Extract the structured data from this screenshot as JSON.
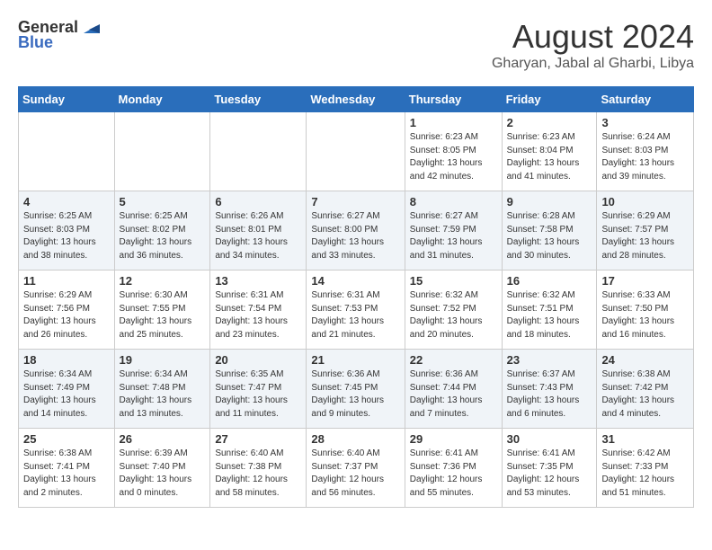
{
  "header": {
    "logo": {
      "general": "General",
      "blue": "Blue"
    },
    "title": "August 2024",
    "location": "Gharyan, Jabal al Gharbi, Libya"
  },
  "days_of_week": [
    "Sunday",
    "Monday",
    "Tuesday",
    "Wednesday",
    "Thursday",
    "Friday",
    "Saturday"
  ],
  "weeks": [
    [
      {
        "day": "",
        "content": ""
      },
      {
        "day": "",
        "content": ""
      },
      {
        "day": "",
        "content": ""
      },
      {
        "day": "",
        "content": ""
      },
      {
        "day": "1",
        "content": "Sunrise: 6:23 AM\nSunset: 8:05 PM\nDaylight: 13 hours\nand 42 minutes."
      },
      {
        "day": "2",
        "content": "Sunrise: 6:23 AM\nSunset: 8:04 PM\nDaylight: 13 hours\nand 41 minutes."
      },
      {
        "day": "3",
        "content": "Sunrise: 6:24 AM\nSunset: 8:03 PM\nDaylight: 13 hours\nand 39 minutes."
      }
    ],
    [
      {
        "day": "4",
        "content": "Sunrise: 6:25 AM\nSunset: 8:03 PM\nDaylight: 13 hours\nand 38 minutes."
      },
      {
        "day": "5",
        "content": "Sunrise: 6:25 AM\nSunset: 8:02 PM\nDaylight: 13 hours\nand 36 minutes."
      },
      {
        "day": "6",
        "content": "Sunrise: 6:26 AM\nSunset: 8:01 PM\nDaylight: 13 hours\nand 34 minutes."
      },
      {
        "day": "7",
        "content": "Sunrise: 6:27 AM\nSunset: 8:00 PM\nDaylight: 13 hours\nand 33 minutes."
      },
      {
        "day": "8",
        "content": "Sunrise: 6:27 AM\nSunset: 7:59 PM\nDaylight: 13 hours\nand 31 minutes."
      },
      {
        "day": "9",
        "content": "Sunrise: 6:28 AM\nSunset: 7:58 PM\nDaylight: 13 hours\nand 30 minutes."
      },
      {
        "day": "10",
        "content": "Sunrise: 6:29 AM\nSunset: 7:57 PM\nDaylight: 13 hours\nand 28 minutes."
      }
    ],
    [
      {
        "day": "11",
        "content": "Sunrise: 6:29 AM\nSunset: 7:56 PM\nDaylight: 13 hours\nand 26 minutes."
      },
      {
        "day": "12",
        "content": "Sunrise: 6:30 AM\nSunset: 7:55 PM\nDaylight: 13 hours\nand 25 minutes."
      },
      {
        "day": "13",
        "content": "Sunrise: 6:31 AM\nSunset: 7:54 PM\nDaylight: 13 hours\nand 23 minutes."
      },
      {
        "day": "14",
        "content": "Sunrise: 6:31 AM\nSunset: 7:53 PM\nDaylight: 13 hours\nand 21 minutes."
      },
      {
        "day": "15",
        "content": "Sunrise: 6:32 AM\nSunset: 7:52 PM\nDaylight: 13 hours\nand 20 minutes."
      },
      {
        "day": "16",
        "content": "Sunrise: 6:32 AM\nSunset: 7:51 PM\nDaylight: 13 hours\nand 18 minutes."
      },
      {
        "day": "17",
        "content": "Sunrise: 6:33 AM\nSunset: 7:50 PM\nDaylight: 13 hours\nand 16 minutes."
      }
    ],
    [
      {
        "day": "18",
        "content": "Sunrise: 6:34 AM\nSunset: 7:49 PM\nDaylight: 13 hours\nand 14 minutes."
      },
      {
        "day": "19",
        "content": "Sunrise: 6:34 AM\nSunset: 7:48 PM\nDaylight: 13 hours\nand 13 minutes."
      },
      {
        "day": "20",
        "content": "Sunrise: 6:35 AM\nSunset: 7:47 PM\nDaylight: 13 hours\nand 11 minutes."
      },
      {
        "day": "21",
        "content": "Sunrise: 6:36 AM\nSunset: 7:45 PM\nDaylight: 13 hours\nand 9 minutes."
      },
      {
        "day": "22",
        "content": "Sunrise: 6:36 AM\nSunset: 7:44 PM\nDaylight: 13 hours\nand 7 minutes."
      },
      {
        "day": "23",
        "content": "Sunrise: 6:37 AM\nSunset: 7:43 PM\nDaylight: 13 hours\nand 6 minutes."
      },
      {
        "day": "24",
        "content": "Sunrise: 6:38 AM\nSunset: 7:42 PM\nDaylight: 13 hours\nand 4 minutes."
      }
    ],
    [
      {
        "day": "25",
        "content": "Sunrise: 6:38 AM\nSunset: 7:41 PM\nDaylight: 13 hours\nand 2 minutes."
      },
      {
        "day": "26",
        "content": "Sunrise: 6:39 AM\nSunset: 7:40 PM\nDaylight: 13 hours\nand 0 minutes."
      },
      {
        "day": "27",
        "content": "Sunrise: 6:40 AM\nSunset: 7:38 PM\nDaylight: 12 hours\nand 58 minutes."
      },
      {
        "day": "28",
        "content": "Sunrise: 6:40 AM\nSunset: 7:37 PM\nDaylight: 12 hours\nand 56 minutes."
      },
      {
        "day": "29",
        "content": "Sunrise: 6:41 AM\nSunset: 7:36 PM\nDaylight: 12 hours\nand 55 minutes."
      },
      {
        "day": "30",
        "content": "Sunrise: 6:41 AM\nSunset: 7:35 PM\nDaylight: 12 hours\nand 53 minutes."
      },
      {
        "day": "31",
        "content": "Sunrise: 6:42 AM\nSunset: 7:33 PM\nDaylight: 12 hours\nand 51 minutes."
      }
    ]
  ]
}
